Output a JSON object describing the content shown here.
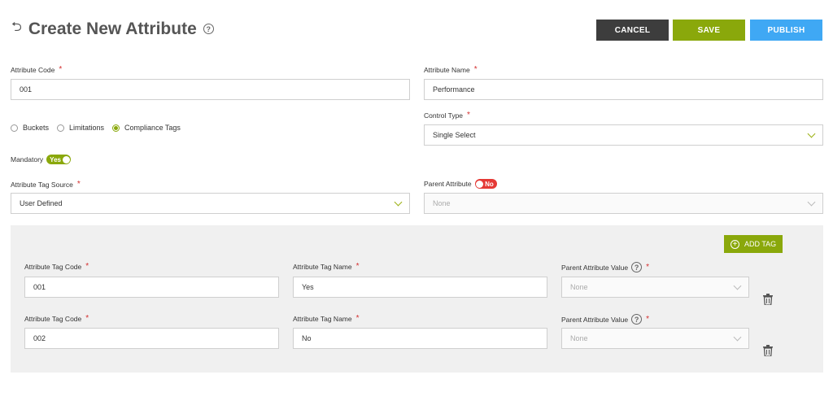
{
  "header": {
    "title": "Create New Attribute",
    "help_glyph": "?",
    "back_glyph": "⮌"
  },
  "toolbar": {
    "cancel_label": "CANCEL",
    "save_label": "SAVE",
    "publish_label": "PUBLISH"
  },
  "colors": {
    "cancel": "#3d3d3d",
    "save": "#8aa80b",
    "publish": "#3fa8f4",
    "toggle_on": "#8aa80b",
    "toggle_off": "#e53935"
  },
  "form": {
    "attribute_code": {
      "label": "Attribute Code",
      "required": "*",
      "value": "001"
    },
    "attribute_name": {
      "label": "Attribute Name",
      "required": "*",
      "value": "Performance"
    },
    "type_radios": [
      {
        "label": "Buckets",
        "selected": false
      },
      {
        "label": "Limitations",
        "selected": false
      },
      {
        "label": "Compliance Tags",
        "selected": true
      }
    ],
    "control_type": {
      "label": "Control Type",
      "required": "*",
      "value": "Single Select"
    },
    "mandatory": {
      "label": "Mandatory",
      "toggle": "Yes"
    },
    "tag_source": {
      "label": "Attribute Tag Source",
      "required": "*",
      "value": "User Defined"
    },
    "parent_attribute": {
      "label": "Parent Attribute",
      "toggle": "No",
      "value": "None"
    }
  },
  "tags": {
    "add_label": "ADD TAG",
    "code_label": "Attribute Tag Code",
    "name_label": "Attribute Tag Name",
    "parent_value_label": "Parent Attribute Value",
    "required": "*",
    "rows": [
      {
        "code": "001",
        "name": "Yes",
        "parent_value": "None"
      },
      {
        "code": "002",
        "name": "No",
        "parent_value": "None"
      }
    ]
  }
}
